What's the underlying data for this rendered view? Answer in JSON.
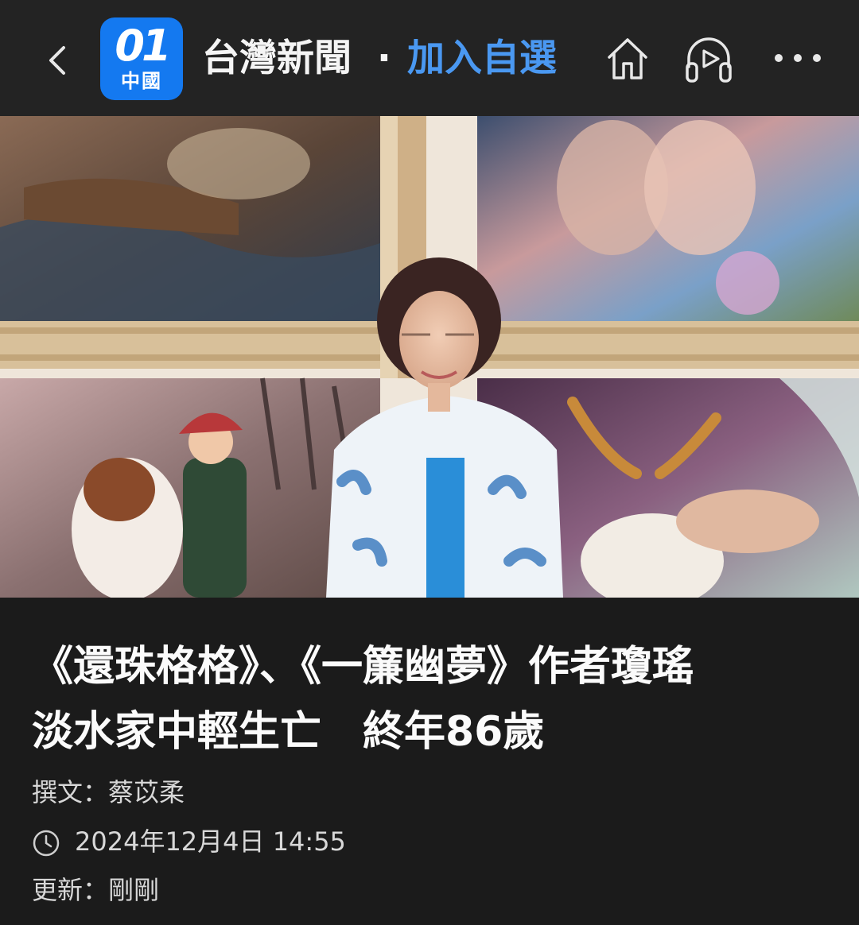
{
  "header": {
    "logo_number": "01",
    "logo_sub": "中國",
    "channel_name": "台灣新聞",
    "separator": "·",
    "follow_label": "加入自選"
  },
  "article": {
    "headline_line1": "《還珠格格》、《一簾幽夢》作者瓊瑤",
    "headline_line2": "淡水家中輕生亡　終年86歲",
    "author": "撰文：蔡苡柔",
    "datetime": "2024年12月4日 14:55",
    "updated": "更新：剛剛"
  },
  "colors": {
    "logo_blue": "#1479f0",
    "follow_blue": "#4a98f1",
    "background": "#1b1b1b"
  },
  "icons": [
    "back-icon",
    "home-icon",
    "headphones-icon",
    "more-icon",
    "clock-icon"
  ]
}
